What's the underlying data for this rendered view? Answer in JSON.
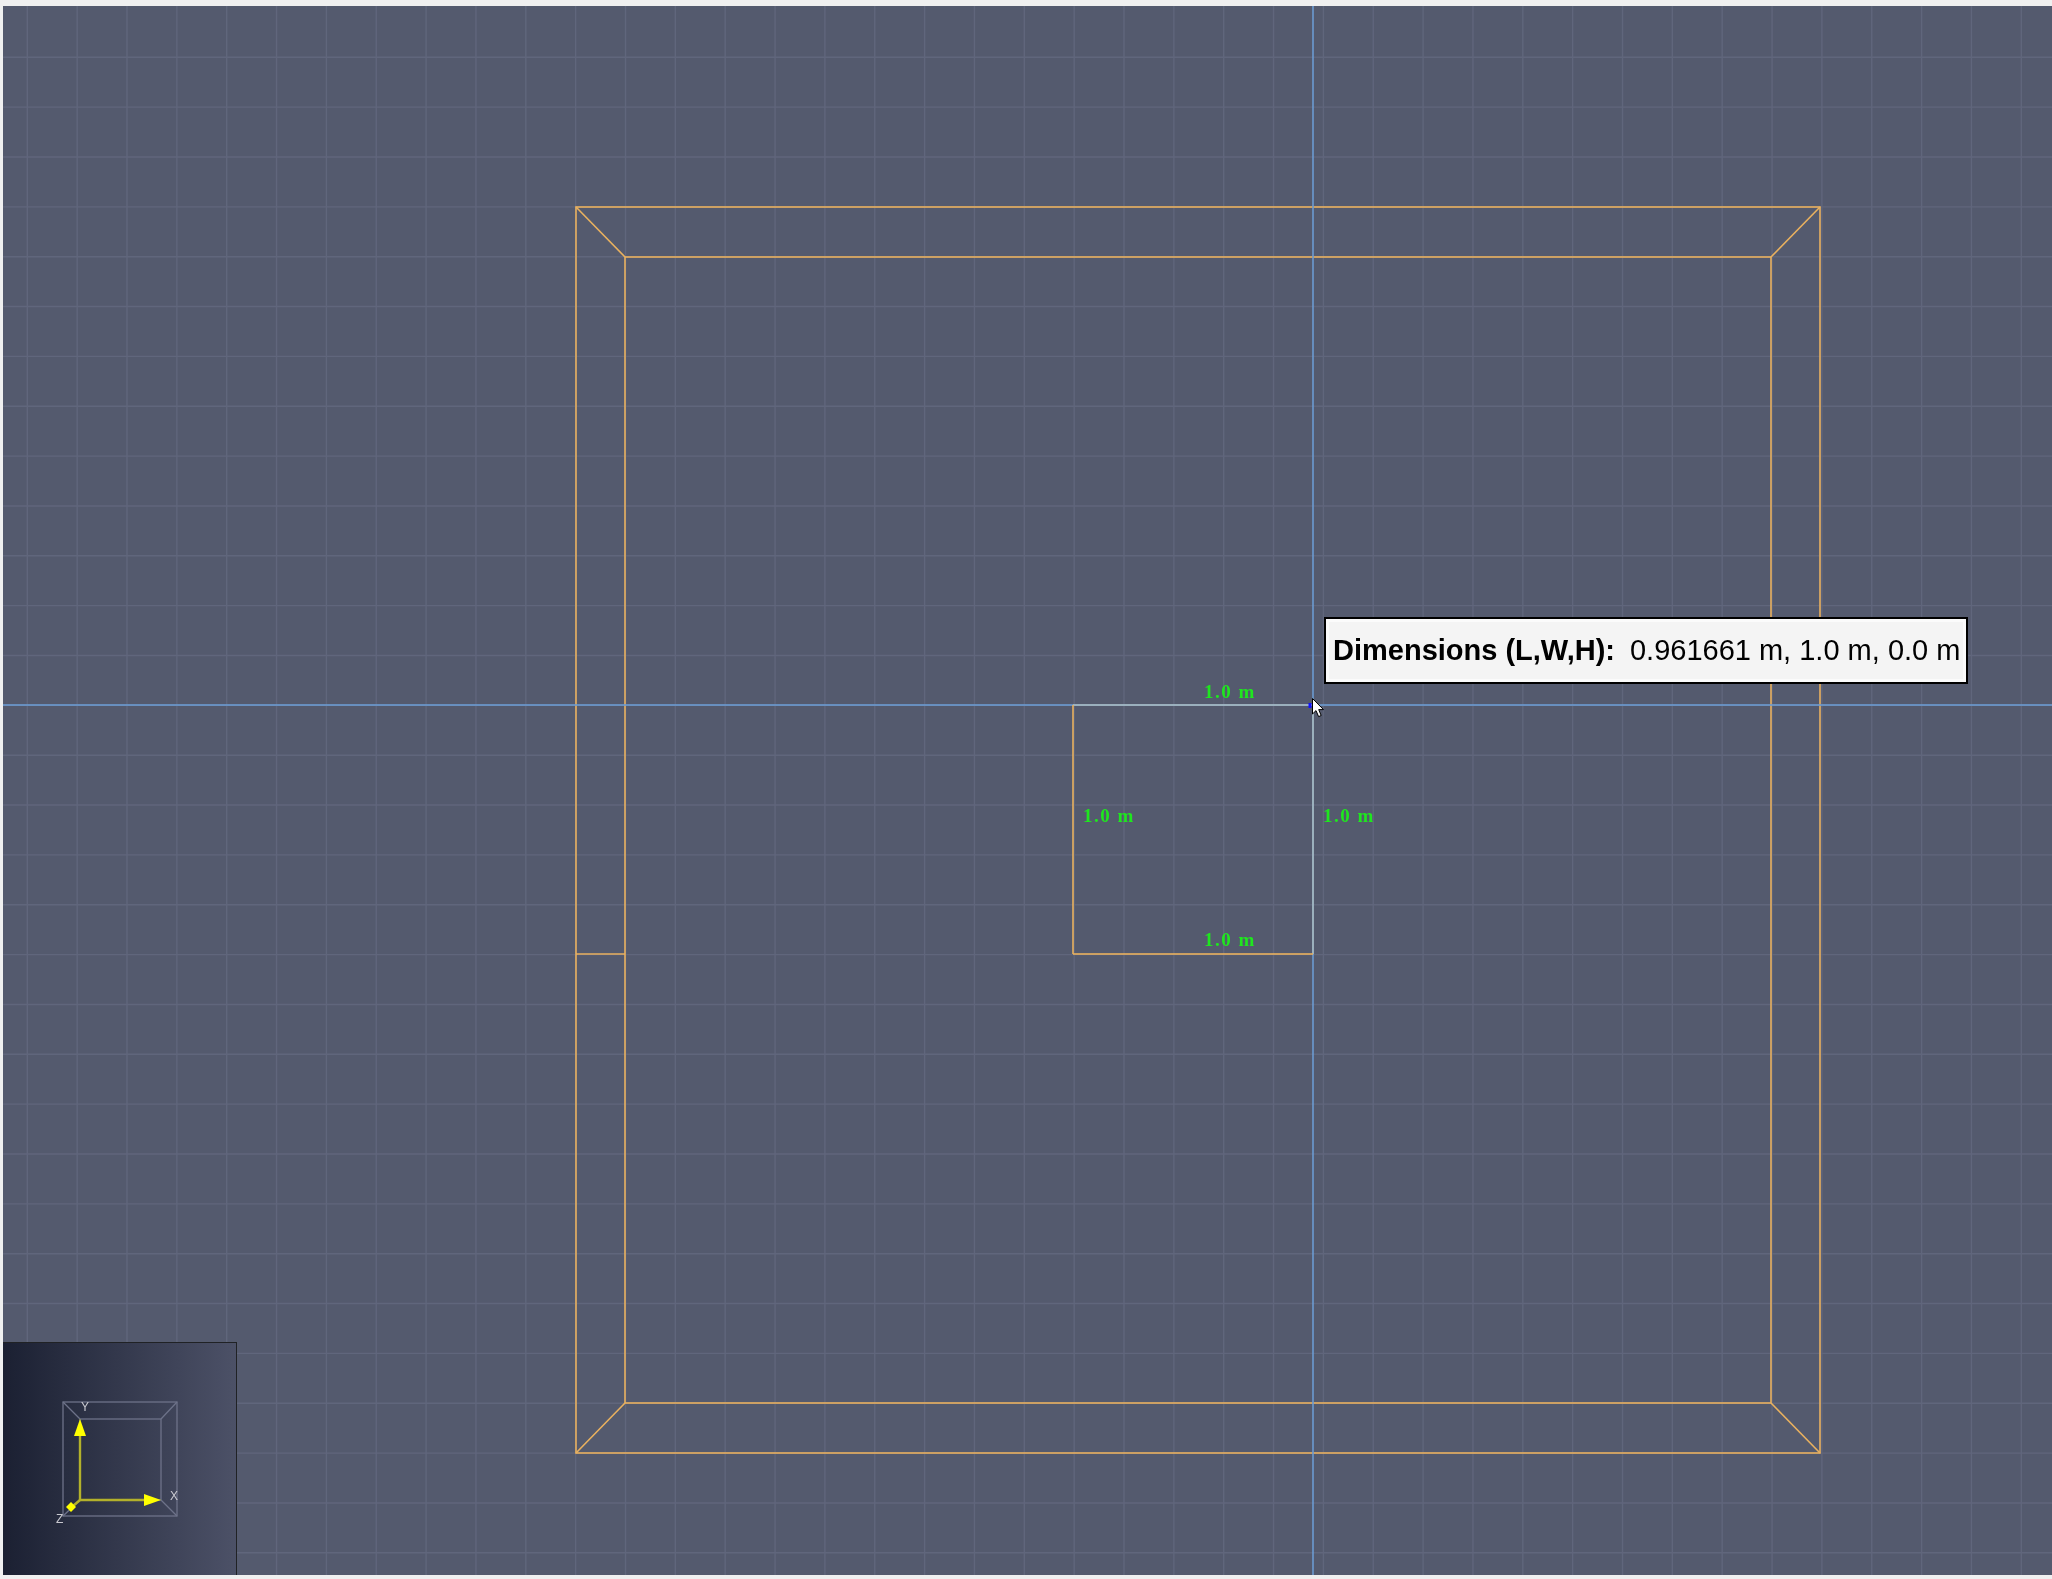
{
  "viewport": {
    "square": {
      "edges": [
        {
          "kind": "top",
          "label": "1.0 m",
          "highlighted": true
        },
        {
          "kind": "left",
          "label": "1.0 m",
          "highlighted": false
        },
        {
          "kind": "right",
          "label": "1.0 m",
          "highlighted": true
        },
        {
          "kind": "bottom",
          "label": "1.0 m",
          "highlighted": false
        }
      ]
    },
    "tooltip": {
      "label": "Dimensions (L,W,H):",
      "value": "0.961661 m, 1.0 m, 0.0 m"
    },
    "axis_gizmo": {
      "axes": [
        {
          "kind": "vertical",
          "label": "Y"
        },
        {
          "kind": "horizontal",
          "label": "X"
        },
        {
          "kind": "depth",
          "label": "Z"
        }
      ]
    }
  }
}
